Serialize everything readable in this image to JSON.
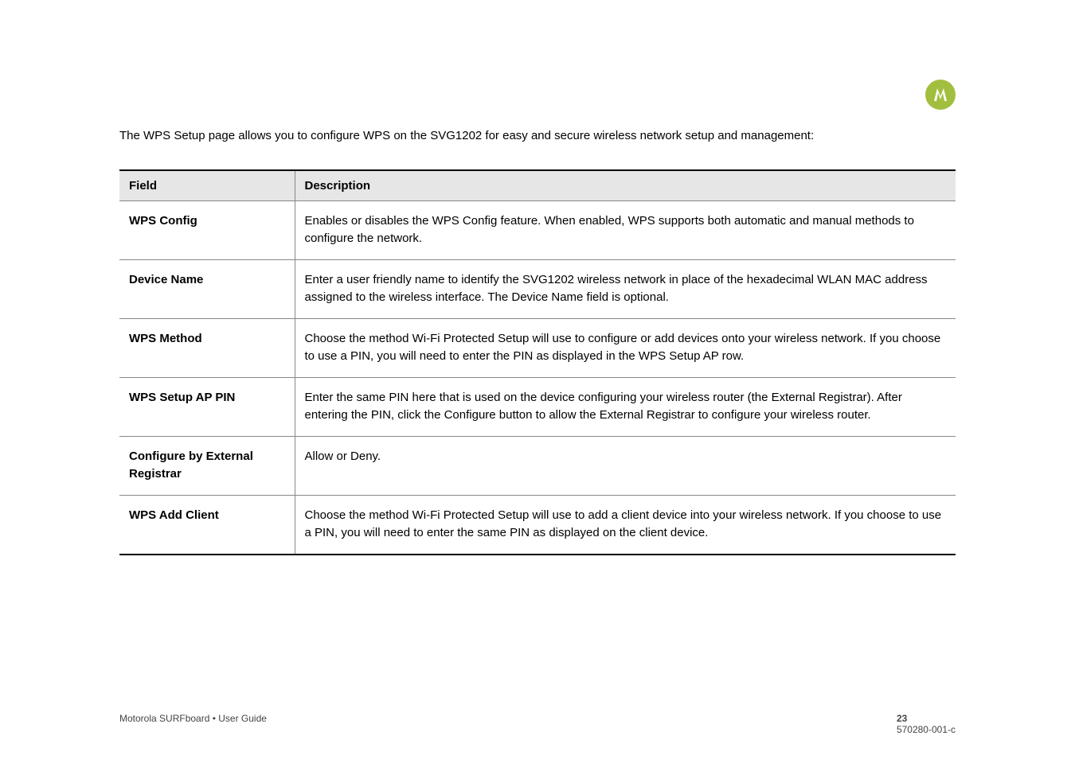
{
  "logo": {
    "name": "motorola-logo"
  },
  "intro": "The WPS Setup page allows you to configure WPS on the SVG1202 for easy and secure wireless network setup and management:",
  "table": {
    "headers": [
      "Field",
      "Description"
    ],
    "rows": [
      {
        "field": "WPS Config",
        "description": "Enables or disables the WPS Config feature. When enabled, WPS supports both automatic and manual methods to configure the network."
      },
      {
        "field": "Device Name",
        "description": "Enter a user friendly name to identify the SVG1202 wireless network in place of the hexadecimal WLAN MAC address assigned to the wireless interface. The Device Name field is optional."
      },
      {
        "field": "WPS Method",
        "description": "Choose the method Wi-Fi Protected Setup will use to configure or add devices onto your wireless network. If you choose to use a PIN, you will need to enter the PIN as displayed in the WPS Setup AP row."
      },
      {
        "field": "WPS Setup AP PIN",
        "description": "Enter the same PIN here that is used on the device configuring your wireless router (the External Registrar). After entering the PIN, click the Configure button to allow the External Registrar to configure your wireless router."
      },
      {
        "field": "Configure by External Registrar",
        "description": "Allow or Deny."
      },
      {
        "field": "WPS Add Client",
        "description": "Choose the method Wi-Fi Protected Setup will use to add a client device into your wireless network. If you choose to use a PIN, you will need to enter the same PIN as displayed on the client device."
      }
    ]
  },
  "footer": {
    "left": "Motorola SURFboard • User Guide",
    "right": "23",
    "rightSuffix": "570280-001-c"
  }
}
